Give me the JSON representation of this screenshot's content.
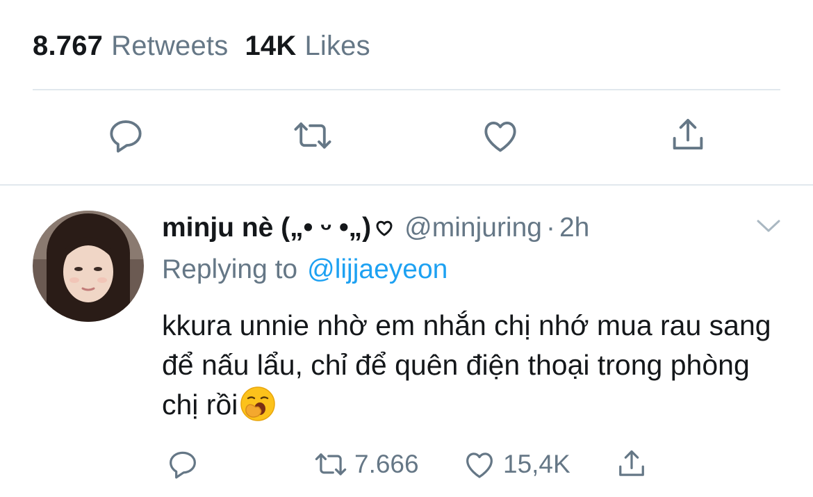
{
  "stats": {
    "retweets_count": "8.767",
    "retweets_label": "Retweets",
    "likes_count": "14K",
    "likes_label": "Likes"
  },
  "main_actions": {
    "icons": [
      "reply-icon",
      "retweet-icon",
      "like-icon",
      "share-icon"
    ]
  },
  "reply": {
    "display_name": "minju nè („• ᵕ •„)",
    "handle": "@minjuring",
    "separator": "·",
    "time": "2h",
    "replying_label": "Replying to",
    "replying_to": "@lijjaeyeon",
    "text": "kkura unnie nhờ em nhắn chị nhớ mua rau sang để nấu lẩu, chỉ để quên điện thoại trong phòng chị rồi",
    "retweet_count": "7.666",
    "like_count": "15,4K"
  },
  "colors": {
    "text": "#14171a",
    "secondary": "#657786",
    "link": "#1da1f2",
    "divider": "#e1e8ed"
  }
}
